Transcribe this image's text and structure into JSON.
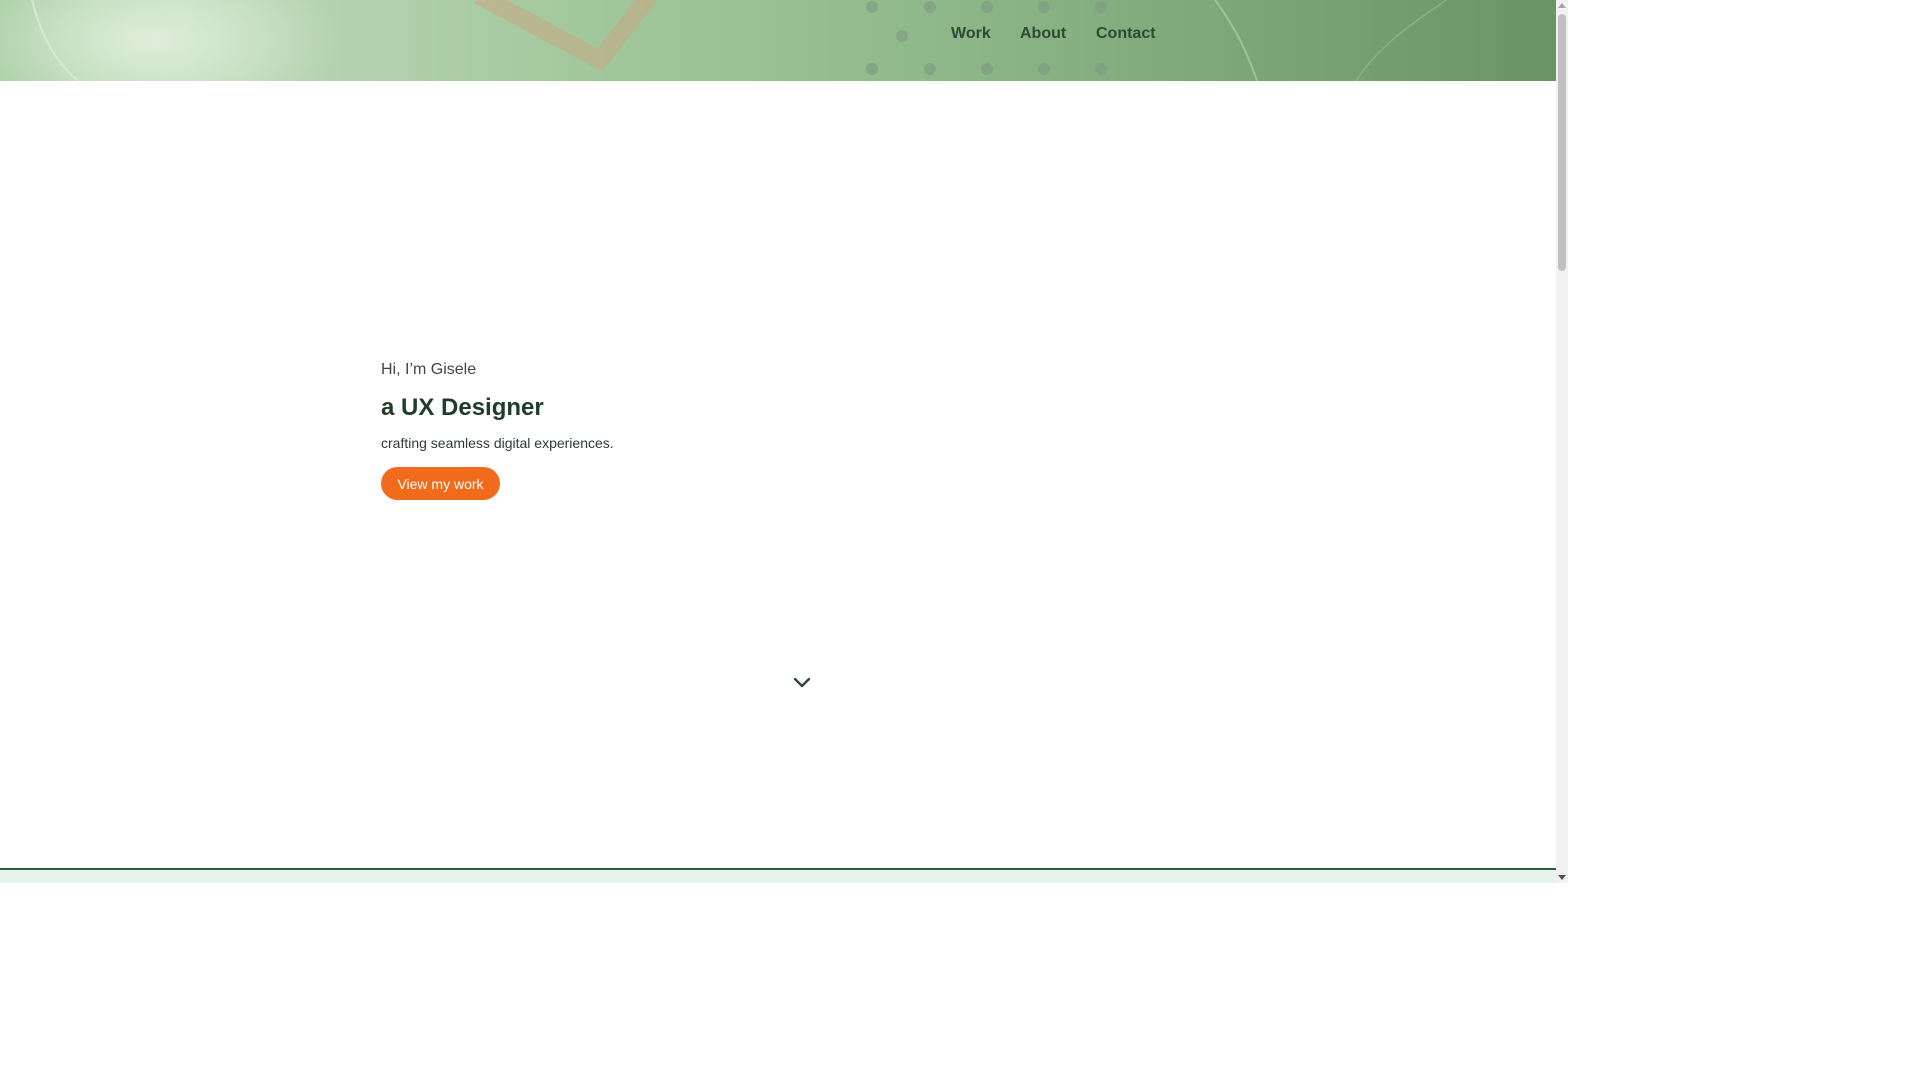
{
  "nav": {
    "items": [
      {
        "label": "Work"
      },
      {
        "label": "About"
      },
      {
        "label": "Contact"
      }
    ]
  },
  "hero": {
    "greeting": "Hi, I’m Gisele",
    "title": "a UX Designer",
    "subtitle": "crafting seamless digital experiences.",
    "cta_label": "View my work"
  },
  "icons": {
    "scroll": "chevron-down-icon"
  },
  "colors": {
    "accent": "#f26a1b",
    "heading": "#1f3b2a",
    "nav_text": "#2e4a33",
    "header_green": "#8fb88a"
  }
}
